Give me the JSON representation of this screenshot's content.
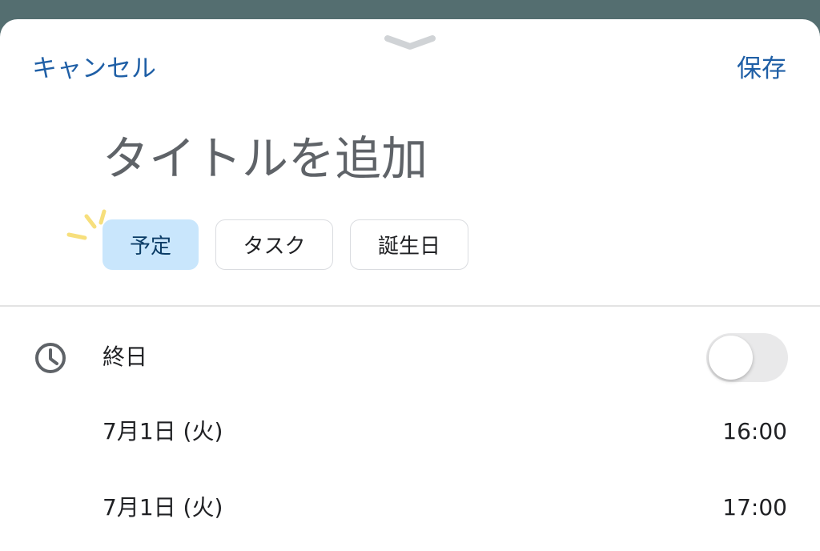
{
  "header": {
    "cancel_label": "キャンセル",
    "save_label": "保存",
    "drag_handle_icon": "chevron-down-icon"
  },
  "title_input": {
    "placeholder": "タイトルを追加",
    "value": ""
  },
  "event_type_chips": [
    {
      "label": "予定",
      "selected": true
    },
    {
      "label": "タスク",
      "selected": false
    },
    {
      "label": "誕生日",
      "selected": false
    }
  ],
  "all_day": {
    "icon": "clock-icon",
    "label": "終日",
    "enabled": false
  },
  "start": {
    "date": "7月1日 (火)",
    "time": "16:00"
  },
  "end": {
    "date": "7月1日 (火)",
    "time": "17:00"
  },
  "colors": {
    "accent": "#1f5fa6",
    "backdrop": "#546e70",
    "selected_chip_bg": "#c9e6fc",
    "sparkle": "#f7df7c"
  }
}
